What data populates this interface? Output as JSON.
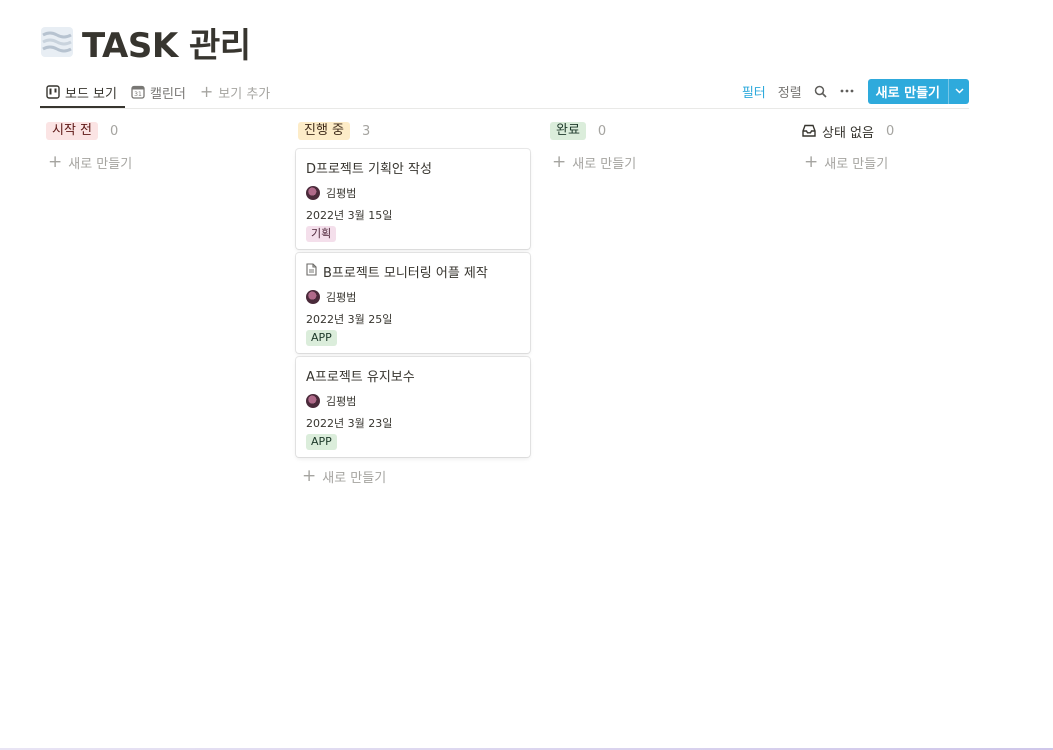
{
  "page": {
    "emoji": "fog-icon",
    "title": "TASK 관리"
  },
  "views": {
    "tabs": [
      {
        "label": "보드 보기",
        "icon": "board-icon",
        "active": true
      },
      {
        "label": "캘린더",
        "icon": "calendar-icon",
        "icon_text": "31",
        "active": false
      }
    ],
    "add_label": "보기 추가"
  },
  "toolbar": {
    "filter_label": "필터",
    "sort_label": "정렬",
    "new_label": "새로 만들기",
    "accent_color": "#2eaadc"
  },
  "board": {
    "add_label": "새로 만들기",
    "columns": [
      {
        "label": "시작 전",
        "count": "0",
        "pill_bg": "#fbe4e4",
        "pill_color": "#5d1715",
        "cards": []
      },
      {
        "label": "진행 중",
        "count": "3",
        "pill_bg": "#fdecc8",
        "pill_color": "#402c1b",
        "cards": [
          {
            "title": "D프로젝트 기획안 작성",
            "icon": "",
            "person": "김평범",
            "date": "2022년 3월 15일",
            "tag": "기획",
            "tag_color": "pink"
          },
          {
            "title": "B프로젝트 모니터링 어플 제작",
            "icon": "document-icon",
            "person": "김평범",
            "date": "2022년 3월 25일",
            "tag": "APP",
            "tag_color": "green"
          },
          {
            "title": "A프로젝트 유지보수",
            "icon": "",
            "person": "김평범",
            "date": "2022년 3월 23일",
            "tag": "APP",
            "tag_color": "green"
          }
        ]
      },
      {
        "label": "완료",
        "count": "0",
        "pill_bg": "#dbeddb",
        "pill_color": "#1c3829",
        "cards": []
      },
      {
        "label": "상태 없음",
        "count": "0",
        "icon": "inbox-icon",
        "cards": []
      }
    ]
  }
}
